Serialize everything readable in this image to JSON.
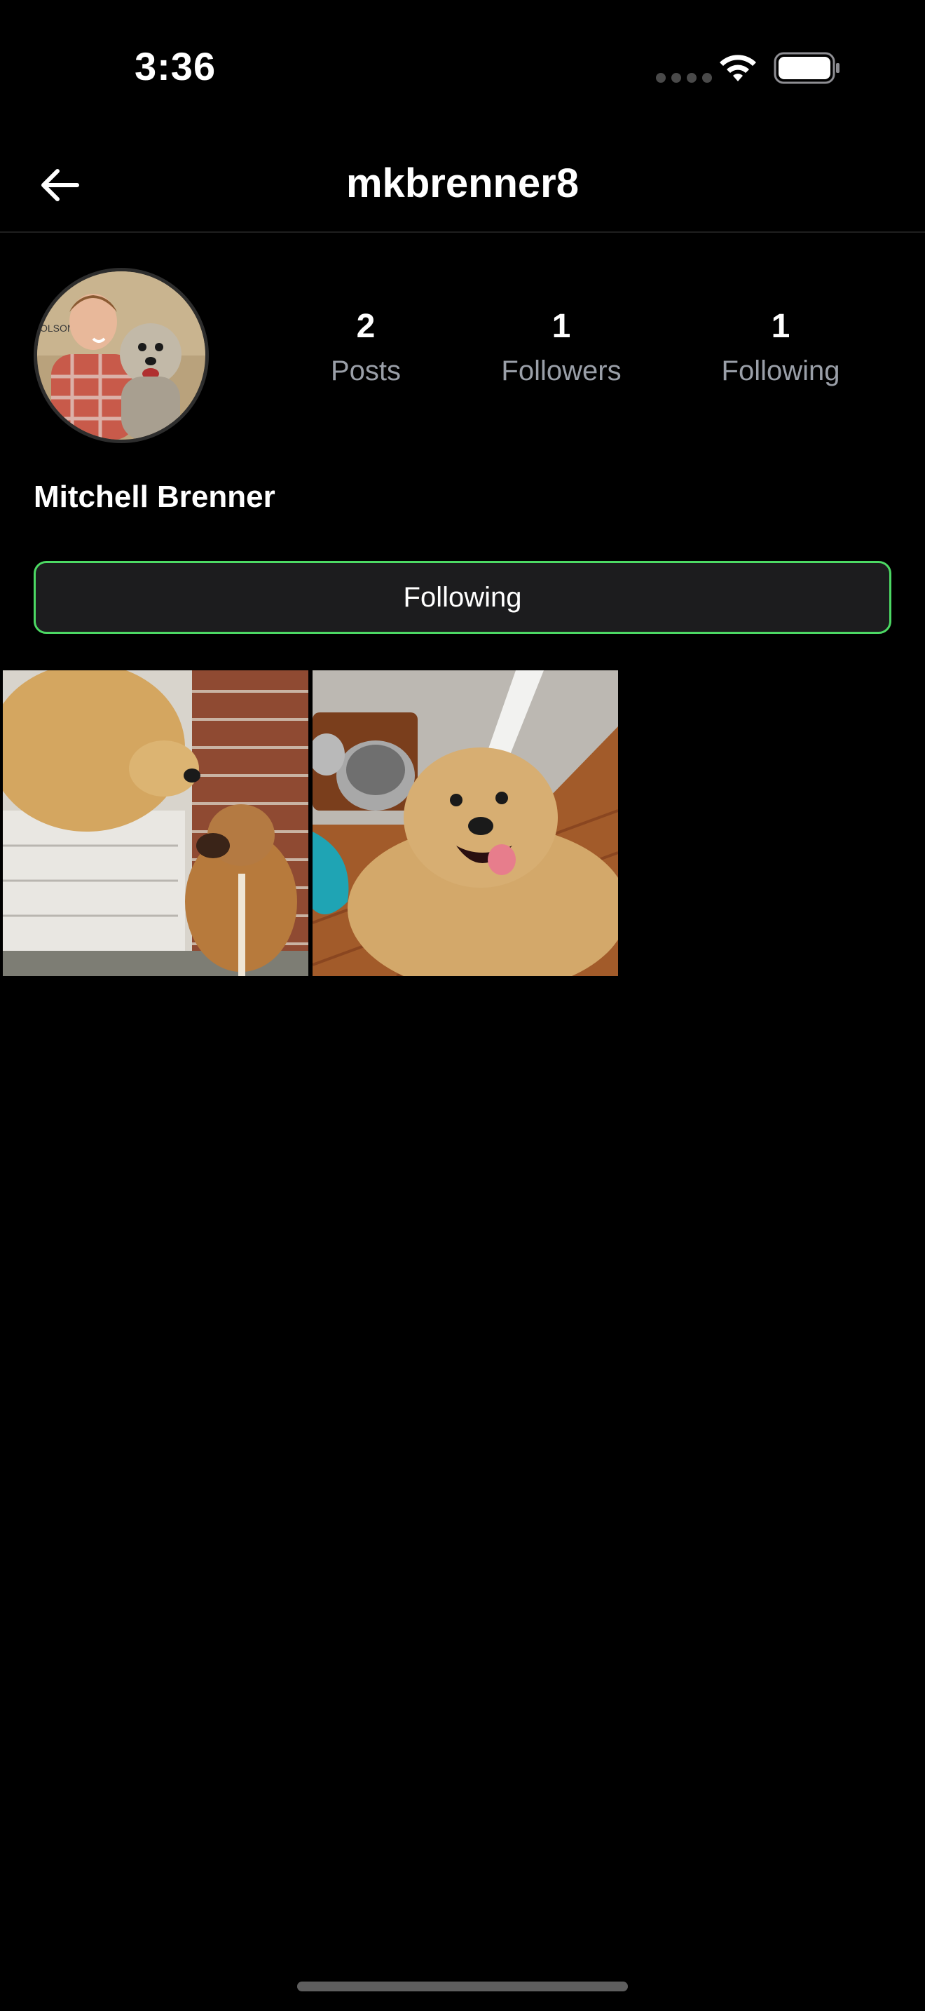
{
  "status_bar": {
    "time": "3:36"
  },
  "header": {
    "title": "mkbrenner8"
  },
  "profile": {
    "display_name": "Mitchell Brenner",
    "avatar_text": "OLSON",
    "stats": [
      {
        "value": "2",
        "label": "Posts"
      },
      {
        "value": "1",
        "label": "Followers"
      },
      {
        "value": "1",
        "label": "Following"
      }
    ],
    "follow_button_label": "Following"
  },
  "colors": {
    "background": "#000000",
    "accent_border": "#4cd964",
    "secondary_text": "#9a9fa8"
  },
  "icons": {
    "back": "arrow-left-icon",
    "wifi": "wifi-icon",
    "battery": "battery-icon"
  }
}
